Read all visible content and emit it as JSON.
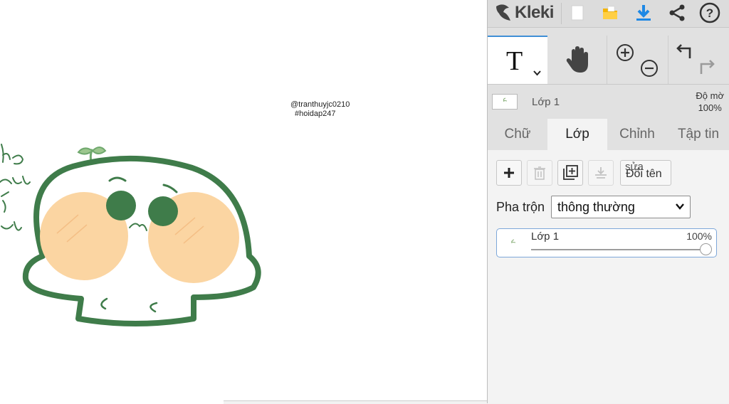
{
  "app": {
    "name": "Kleki"
  },
  "canvas": {
    "watermark_line1": "@tranthuyjc0210",
    "watermark_line2": "#hoidap247"
  },
  "toolbar": {
    "icons": [
      "new-file-icon",
      "open-folder-icon",
      "download-icon",
      "share-icon",
      "help-icon"
    ],
    "tools": [
      "text-tool-icon",
      "hand-tool-icon",
      "zoom-in-icon",
      "zoom-out-icon",
      "undo-icon",
      "redo-icon"
    ],
    "text_tool_glyph": "T",
    "accent": "#1e88e5"
  },
  "layer_header": {
    "name": "Lớp 1",
    "opacity_label_line1": "Độ mờ",
    "opacity_label_line2": "100%"
  },
  "tabs": [
    {
      "label": "Chữ",
      "active": false
    },
    {
      "label": "Lớp",
      "active": true
    },
    {
      "label": "Chỉnh",
      "active": false
    },
    {
      "label": "Tập tin",
      "active": false
    }
  ],
  "layer_panel": {
    "actions": [
      "add-layer-icon",
      "delete-layer-icon",
      "duplicate-layer-icon",
      "merge-down-icon"
    ],
    "rename_top": "sửa",
    "rename_label": "Đổi tên",
    "blend_label": "Pha trộn",
    "blend_value": "thông thường",
    "layers": [
      {
        "name": "Lớp 1",
        "opacity": "100%",
        "opacity_value": 1.0
      }
    ]
  }
}
